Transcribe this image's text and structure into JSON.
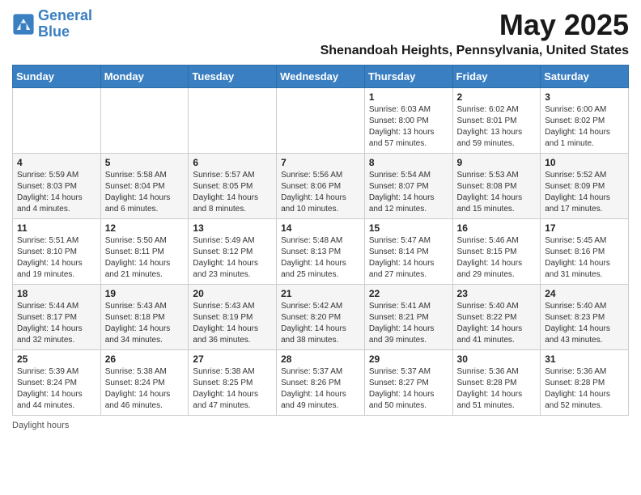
{
  "header": {
    "logo_line1": "General",
    "logo_line2": "Blue",
    "title": "May 2025",
    "subtitle": "Shenandoah Heights, Pennsylvania, United States"
  },
  "weekdays": [
    "Sunday",
    "Monday",
    "Tuesday",
    "Wednesday",
    "Thursday",
    "Friday",
    "Saturday"
  ],
  "weeks": [
    [
      {
        "day": "",
        "sunrise": "",
        "sunset": "",
        "daylight": ""
      },
      {
        "day": "",
        "sunrise": "",
        "sunset": "",
        "daylight": ""
      },
      {
        "day": "",
        "sunrise": "",
        "sunset": "",
        "daylight": ""
      },
      {
        "day": "",
        "sunrise": "",
        "sunset": "",
        "daylight": ""
      },
      {
        "day": "1",
        "sunrise": "6:03 AM",
        "sunset": "8:00 PM",
        "daylight": "13 hours and 57 minutes."
      },
      {
        "day": "2",
        "sunrise": "6:02 AM",
        "sunset": "8:01 PM",
        "daylight": "13 hours and 59 minutes."
      },
      {
        "day": "3",
        "sunrise": "6:00 AM",
        "sunset": "8:02 PM",
        "daylight": "14 hours and 1 minute."
      }
    ],
    [
      {
        "day": "4",
        "sunrise": "5:59 AM",
        "sunset": "8:03 PM",
        "daylight": "14 hours and 4 minutes."
      },
      {
        "day": "5",
        "sunrise": "5:58 AM",
        "sunset": "8:04 PM",
        "daylight": "14 hours and 6 minutes."
      },
      {
        "day": "6",
        "sunrise": "5:57 AM",
        "sunset": "8:05 PM",
        "daylight": "14 hours and 8 minutes."
      },
      {
        "day": "7",
        "sunrise": "5:56 AM",
        "sunset": "8:06 PM",
        "daylight": "14 hours and 10 minutes."
      },
      {
        "day": "8",
        "sunrise": "5:54 AM",
        "sunset": "8:07 PM",
        "daylight": "14 hours and 12 minutes."
      },
      {
        "day": "9",
        "sunrise": "5:53 AM",
        "sunset": "8:08 PM",
        "daylight": "14 hours and 15 minutes."
      },
      {
        "day": "10",
        "sunrise": "5:52 AM",
        "sunset": "8:09 PM",
        "daylight": "14 hours and 17 minutes."
      }
    ],
    [
      {
        "day": "11",
        "sunrise": "5:51 AM",
        "sunset": "8:10 PM",
        "daylight": "14 hours and 19 minutes."
      },
      {
        "day": "12",
        "sunrise": "5:50 AM",
        "sunset": "8:11 PM",
        "daylight": "14 hours and 21 minutes."
      },
      {
        "day": "13",
        "sunrise": "5:49 AM",
        "sunset": "8:12 PM",
        "daylight": "14 hours and 23 minutes."
      },
      {
        "day": "14",
        "sunrise": "5:48 AM",
        "sunset": "8:13 PM",
        "daylight": "14 hours and 25 minutes."
      },
      {
        "day": "15",
        "sunrise": "5:47 AM",
        "sunset": "8:14 PM",
        "daylight": "14 hours and 27 minutes."
      },
      {
        "day": "16",
        "sunrise": "5:46 AM",
        "sunset": "8:15 PM",
        "daylight": "14 hours and 29 minutes."
      },
      {
        "day": "17",
        "sunrise": "5:45 AM",
        "sunset": "8:16 PM",
        "daylight": "14 hours and 31 minutes."
      }
    ],
    [
      {
        "day": "18",
        "sunrise": "5:44 AM",
        "sunset": "8:17 PM",
        "daylight": "14 hours and 32 minutes."
      },
      {
        "day": "19",
        "sunrise": "5:43 AM",
        "sunset": "8:18 PM",
        "daylight": "14 hours and 34 minutes."
      },
      {
        "day": "20",
        "sunrise": "5:43 AM",
        "sunset": "8:19 PM",
        "daylight": "14 hours and 36 minutes."
      },
      {
        "day": "21",
        "sunrise": "5:42 AM",
        "sunset": "8:20 PM",
        "daylight": "14 hours and 38 minutes."
      },
      {
        "day": "22",
        "sunrise": "5:41 AM",
        "sunset": "8:21 PM",
        "daylight": "14 hours and 39 minutes."
      },
      {
        "day": "23",
        "sunrise": "5:40 AM",
        "sunset": "8:22 PM",
        "daylight": "14 hours and 41 minutes."
      },
      {
        "day": "24",
        "sunrise": "5:40 AM",
        "sunset": "8:23 PM",
        "daylight": "14 hours and 43 minutes."
      }
    ],
    [
      {
        "day": "25",
        "sunrise": "5:39 AM",
        "sunset": "8:24 PM",
        "daylight": "14 hours and 44 minutes."
      },
      {
        "day": "26",
        "sunrise": "5:38 AM",
        "sunset": "8:24 PM",
        "daylight": "14 hours and 46 minutes."
      },
      {
        "day": "27",
        "sunrise": "5:38 AM",
        "sunset": "8:25 PM",
        "daylight": "14 hours and 47 minutes."
      },
      {
        "day": "28",
        "sunrise": "5:37 AM",
        "sunset": "8:26 PM",
        "daylight": "14 hours and 49 minutes."
      },
      {
        "day": "29",
        "sunrise": "5:37 AM",
        "sunset": "8:27 PM",
        "daylight": "14 hours and 50 minutes."
      },
      {
        "day": "30",
        "sunrise": "5:36 AM",
        "sunset": "8:28 PM",
        "daylight": "14 hours and 51 minutes."
      },
      {
        "day": "31",
        "sunrise": "5:36 AM",
        "sunset": "8:28 PM",
        "daylight": "14 hours and 52 minutes."
      }
    ]
  ],
  "footer": "Daylight hours"
}
